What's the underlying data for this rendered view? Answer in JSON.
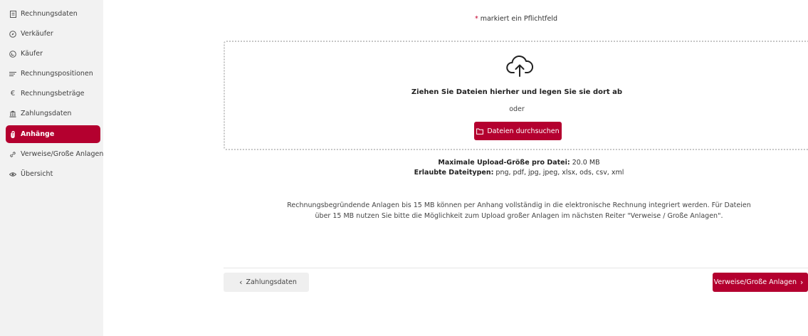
{
  "sidebar": {
    "items": [
      {
        "label": "Rechnungsdaten",
        "icon": "document-icon"
      },
      {
        "label": "Verkäufer",
        "icon": "compass-icon"
      },
      {
        "label": "Käufer",
        "icon": "circle-arrow-icon"
      },
      {
        "label": "Rechnungspositionen",
        "icon": "list-icon"
      },
      {
        "label": "Rechnungsbeträge",
        "icon": "euro-icon"
      },
      {
        "label": "Zahlungsdaten",
        "icon": "bank-icon"
      },
      {
        "label": "Anhänge",
        "icon": "paperclip-icon",
        "active": true
      },
      {
        "label": "Verweise/Große Anlagen",
        "icon": "link-icon"
      },
      {
        "label": "Übersicht",
        "icon": "eye-icon"
      }
    ]
  },
  "form": {
    "required_star": "*",
    "required_note": "markiert ein Pflichtfeld"
  },
  "dropzone": {
    "title": "Ziehen Sie Dateien hierher und legen Sie sie dort ab",
    "or": "oder",
    "browse_label": "Dateien durchsuchen"
  },
  "limits": {
    "max_size_label": "Maximale Upload-Größe pro Datei:",
    "max_size_value": "20.0 MB",
    "types_label": "Erlaubte Dateitypen:",
    "types_value": "png, pdf, jpg, jpeg, xlsx, ods, csv, xml"
  },
  "note": {
    "line1": "Rechnungsbegründende Anlagen bis 15 MB können per Anhang vollständig in die elektronische Rechnung integriert werden. Für Dateien",
    "line2": "über 15 MB nutzen Sie bitte die Möglichkeit zum Upload großer Anlagen im nächsten Reiter \"Verweise / Große Anlagen\"."
  },
  "navigation": {
    "prev_label": "Zahlungsdaten",
    "next_label": "Verweise/Große Anlagen"
  },
  "colors": {
    "accent": "#b4002f",
    "sidebar_bg": "#f2f2f2"
  }
}
